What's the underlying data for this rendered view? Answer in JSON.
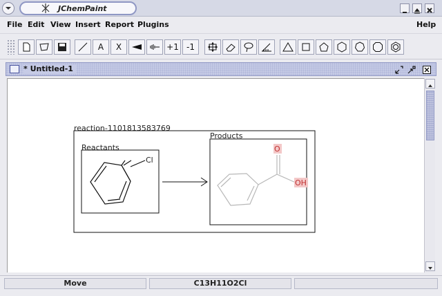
{
  "window": {
    "title": "JChemPaint",
    "controls": [
      "minimize-icon",
      "maximize-icon",
      "close-icon"
    ]
  },
  "menu": {
    "items": [
      "File",
      "Edit",
      "View",
      "Insert",
      "Report",
      "Plugins"
    ],
    "help": "Help"
  },
  "toolbar": {
    "buttons": [
      {
        "name": "new-document-icon"
      },
      {
        "name": "lasso-select-icon"
      },
      {
        "name": "save-icon"
      },
      {
        "name": "bond-tool-icon"
      },
      {
        "name": "text-tool-icon",
        "label": "A"
      },
      {
        "name": "cross-tool-icon",
        "label": "X"
      },
      {
        "name": "wedge-bond-icon"
      },
      {
        "name": "hatch-bond-icon"
      },
      {
        "name": "increase-charge-button",
        "label": "+1"
      },
      {
        "name": "decrease-charge-button",
        "label": "-1"
      },
      {
        "name": "move-tool-icon"
      },
      {
        "name": "eraser-icon"
      },
      {
        "name": "lasso-icon"
      },
      {
        "name": "ruler-icon"
      },
      {
        "name": "triangle-ring-icon"
      },
      {
        "name": "square-ring-icon"
      },
      {
        "name": "pentagon-ring-icon"
      },
      {
        "name": "hexagon-ring-icon"
      },
      {
        "name": "heptagon-ring-icon"
      },
      {
        "name": "octagon-ring-icon"
      },
      {
        "name": "benzene-ring-icon"
      }
    ]
  },
  "document": {
    "title": "* Untitled-1"
  },
  "reaction": {
    "id_label": "reaction-1101813583769",
    "reactants_label": "Reactants",
    "products_label": "Products",
    "reactant_atoms": [
      "Cl"
    ],
    "product_atoms": [
      "O",
      "OH"
    ]
  },
  "status": {
    "mode": "Move",
    "formula": "C13H11O2Cl",
    "extra": ""
  },
  "colors": {
    "title_bar": "#d6d9e6",
    "frame_accent": "#8f97c4",
    "oxygen_highlight": "#f3c8c8",
    "oxygen_text": "#c03030",
    "product_bond": "#b8b8b8"
  }
}
